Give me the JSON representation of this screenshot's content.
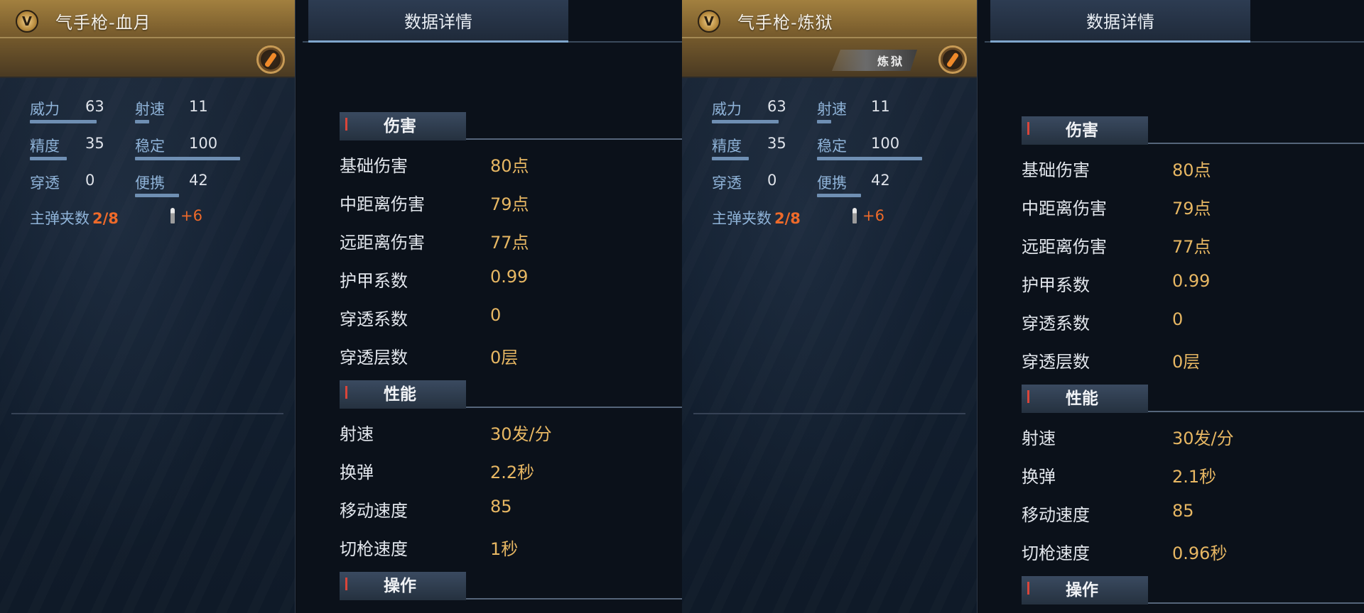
{
  "panels": [
    {
      "weapon_name": "气手枪-血月",
      "badge_letter": "V",
      "tier_badge": "",
      "stats": [
        {
          "label": "威力",
          "value": "63"
        },
        {
          "label": "射速",
          "value": "11"
        },
        {
          "label": "精度",
          "value": "35"
        },
        {
          "label": "稳定",
          "value": "100"
        },
        {
          "label": "穿透",
          "value": "0"
        },
        {
          "label": "便携",
          "value": "42"
        }
      ],
      "magazine_label": "主弹夹数",
      "magazine_value": "2/8",
      "extra_ammo": "+6",
      "tab_label": "数据详情",
      "sections": [
        {
          "title": "伤害",
          "rows": [
            {
              "label": "基础伤害",
              "value": "80点"
            },
            {
              "label": "中距离伤害",
              "value": "79点"
            },
            {
              "label": "远距离伤害",
              "value": "77点"
            },
            {
              "label": "护甲系数",
              "value": "0.99"
            },
            {
              "label": "穿透系数",
              "value": "0"
            },
            {
              "label": "穿透层数",
              "value": "0层"
            }
          ]
        },
        {
          "title": "性能",
          "rows": [
            {
              "label": "射速",
              "value": "30发/分"
            },
            {
              "label": "换弹",
              "value": "2.2秒"
            },
            {
              "label": "移动速度",
              "value": "85"
            },
            {
              "label": "切枪速度",
              "value": "1秒"
            }
          ]
        },
        {
          "title": "操作",
          "rows": []
        }
      ]
    },
    {
      "weapon_name": "气手枪-炼狱",
      "badge_letter": "V",
      "tier_badge": "炼狱",
      "stats": [
        {
          "label": "威力",
          "value": "63"
        },
        {
          "label": "射速",
          "value": "11"
        },
        {
          "label": "精度",
          "value": "35"
        },
        {
          "label": "稳定",
          "value": "100"
        },
        {
          "label": "穿透",
          "value": "0"
        },
        {
          "label": "便携",
          "value": "42"
        }
      ],
      "magazine_label": "主弹夹数",
      "magazine_value": "2/8",
      "extra_ammo": "+6",
      "tab_label": "数据详情",
      "sections": [
        {
          "title": "伤害",
          "rows": [
            {
              "label": "基础伤害",
              "value": "80点"
            },
            {
              "label": "中距离伤害",
              "value": "79点"
            },
            {
              "label": "远距离伤害",
              "value": "77点"
            },
            {
              "label": "护甲系数",
              "value": "0.99"
            },
            {
              "label": "穿透系数",
              "value": "0"
            },
            {
              "label": "穿透层数",
              "value": "0层"
            }
          ]
        },
        {
          "title": "性能",
          "rows": [
            {
              "label": "射速",
              "value": "30发/分"
            },
            {
              "label": "换弹",
              "value": "2.1秒"
            },
            {
              "label": "移动速度",
              "value": "85"
            },
            {
              "label": "切枪速度",
              "value": "0.96秒"
            }
          ]
        },
        {
          "title": "操作",
          "rows": []
        }
      ]
    }
  ],
  "colors": {
    "value_gold": "#e7b763",
    "stat_label_blue": "#8fb3d8",
    "magazine_orange": "#ee6a2a",
    "card_header_gold": "#a2803f"
  },
  "icons": [
    "v-rank-badge-icon",
    "pistol-type-icon",
    "bullet-icon",
    "tier-wing-badge-icon"
  ]
}
